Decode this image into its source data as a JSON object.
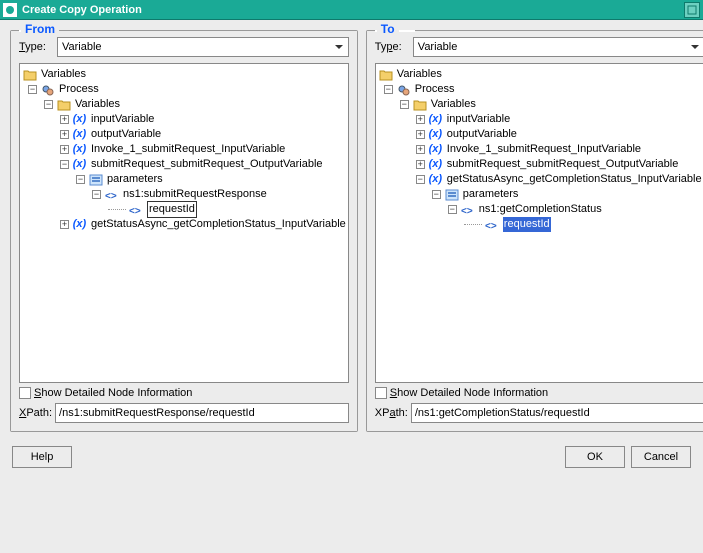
{
  "window": {
    "title": "Create Copy Operation"
  },
  "footer": {
    "help": "Help",
    "ok": "OK",
    "cancel": "Cancel"
  },
  "common": {
    "type_label": "Type:",
    "show_detail": "Show Detailed Node Information",
    "xpath_label": "XPath:"
  },
  "from": {
    "title": "From",
    "type_value": "Variable",
    "xpath_value": "/ns1:submitRequestResponse/requestId",
    "tree": {
      "root": "Variables",
      "process": "Process",
      "varsFolder": "Variables",
      "items": [
        "inputVariable",
        "outputVariable",
        "Invoke_1_submitRequest_InputVariable",
        "submitRequest_submitRequest_OutputVariable",
        "getStatusAsync_getCompletionStatus_InputVariable"
      ],
      "expanded": {
        "params": "parameters",
        "child": "ns1:submitRequestResponse",
        "leaf": "requestId"
      }
    }
  },
  "to": {
    "title": "To",
    "type_value": "Variable",
    "xpath_value": "/ns1:getCompletionStatus/requestId",
    "tree": {
      "root": "Variables",
      "process": "Process",
      "varsFolder": "Variables",
      "items": [
        "inputVariable",
        "outputVariable",
        "Invoke_1_submitRequest_InputVariable",
        "submitRequest_submitRequest_OutputVariable",
        "getStatusAsync_getCompletionStatus_InputVariable"
      ],
      "expanded": {
        "params": "parameters",
        "child": "ns1:getCompletionStatus",
        "leaf": "requestId"
      }
    }
  }
}
